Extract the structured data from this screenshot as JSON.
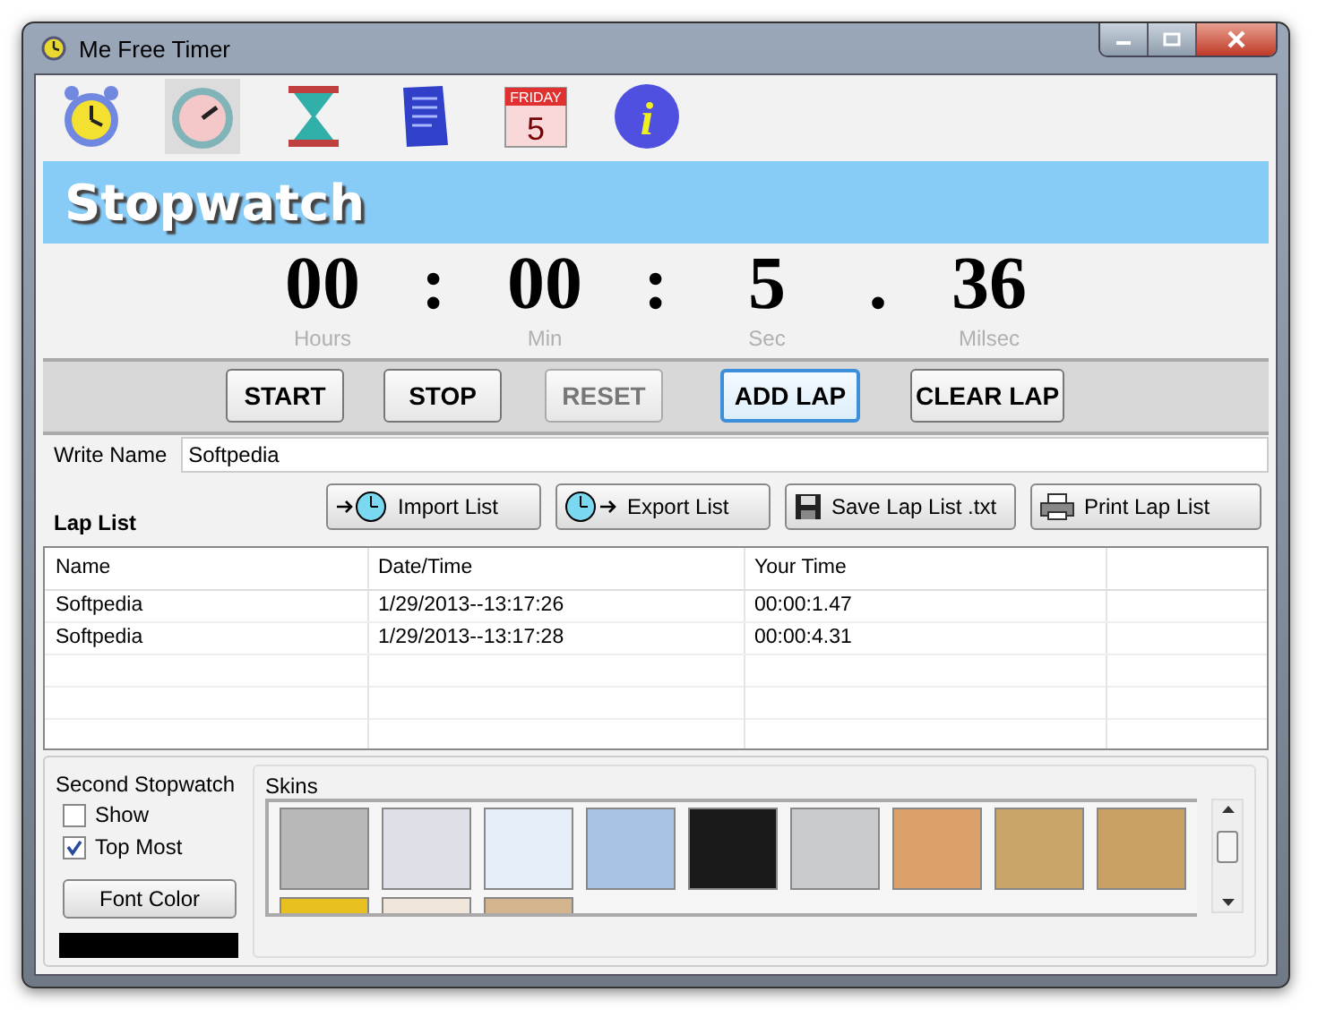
{
  "window": {
    "title": "Me Free Timer"
  },
  "toolbar": [
    {
      "kind": "alarm",
      "selected": false
    },
    {
      "kind": "stopwatch",
      "selected": true
    },
    {
      "kind": "hourglass",
      "selected": false
    },
    {
      "kind": "note",
      "selected": false
    },
    {
      "kind": "calendar",
      "selected": false,
      "day": "FRIDAY",
      "date": "5"
    },
    {
      "kind": "info",
      "selected": false,
      "glyph": "i"
    }
  ],
  "banner": {
    "title": "Stopwatch"
  },
  "timer": {
    "parts": [
      {
        "value": "00",
        "label": "Hours"
      },
      {
        "value": "00",
        "label": "Min"
      },
      {
        "value": "5",
        "label": "Sec"
      },
      {
        "value": "36",
        "label": "Milsec"
      }
    ],
    "separators": [
      ":",
      ":",
      "."
    ]
  },
  "controls": [
    {
      "label": "START",
      "disabled": false,
      "focused": false
    },
    {
      "label": "STOP",
      "disabled": false,
      "focused": false
    },
    {
      "label": "RESET",
      "disabled": true,
      "focused": false
    },
    {
      "label": "ADD LAP",
      "disabled": false,
      "focused": true
    },
    {
      "label": "CLEAR LAP",
      "disabled": false,
      "focused": false
    }
  ],
  "name_field": {
    "label": "Write Name",
    "value": "Softpedia"
  },
  "lap_list": {
    "title": "Lap List",
    "actions": [
      {
        "kind": "import",
        "label": "Import List"
      },
      {
        "kind": "export",
        "label": "Export List"
      },
      {
        "kind": "save",
        "label": "Save Lap List .txt"
      },
      {
        "kind": "print",
        "label": "Print Lap List"
      }
    ],
    "columns": [
      "Name",
      "Date/Time",
      "Your Time"
    ],
    "rows": [
      [
        "Softpedia",
        "1/29/2013--13:17:26",
        "00:00:1.47"
      ],
      [
        "Softpedia",
        "1/29/2013--13:17:28",
        "00:00:4.31"
      ]
    ]
  },
  "second_stopwatch": {
    "title": "Second Stopwatch",
    "options": [
      {
        "label": "Show",
        "checked": false
      },
      {
        "label": "Top Most",
        "checked": true
      }
    ],
    "font_color_button": "Font Color"
  },
  "skins": {
    "title": "Skins",
    "items": [
      {
        "color": "#b8b8b8"
      },
      {
        "color": "#dde0e6"
      },
      {
        "color": "#e6eefa"
      },
      {
        "color": "#a8c4e4"
      },
      {
        "color": "#1a1a1a"
      },
      {
        "color": "#c8cccf"
      },
      {
        "color": "#dca06a"
      },
      {
        "color": "#c9a56a"
      },
      {
        "color": "#c8a064"
      },
      {
        "color": "#e8c020"
      },
      {
        "color": "#f0e6dc"
      },
      {
        "color": "#d4b48c"
      }
    ]
  }
}
